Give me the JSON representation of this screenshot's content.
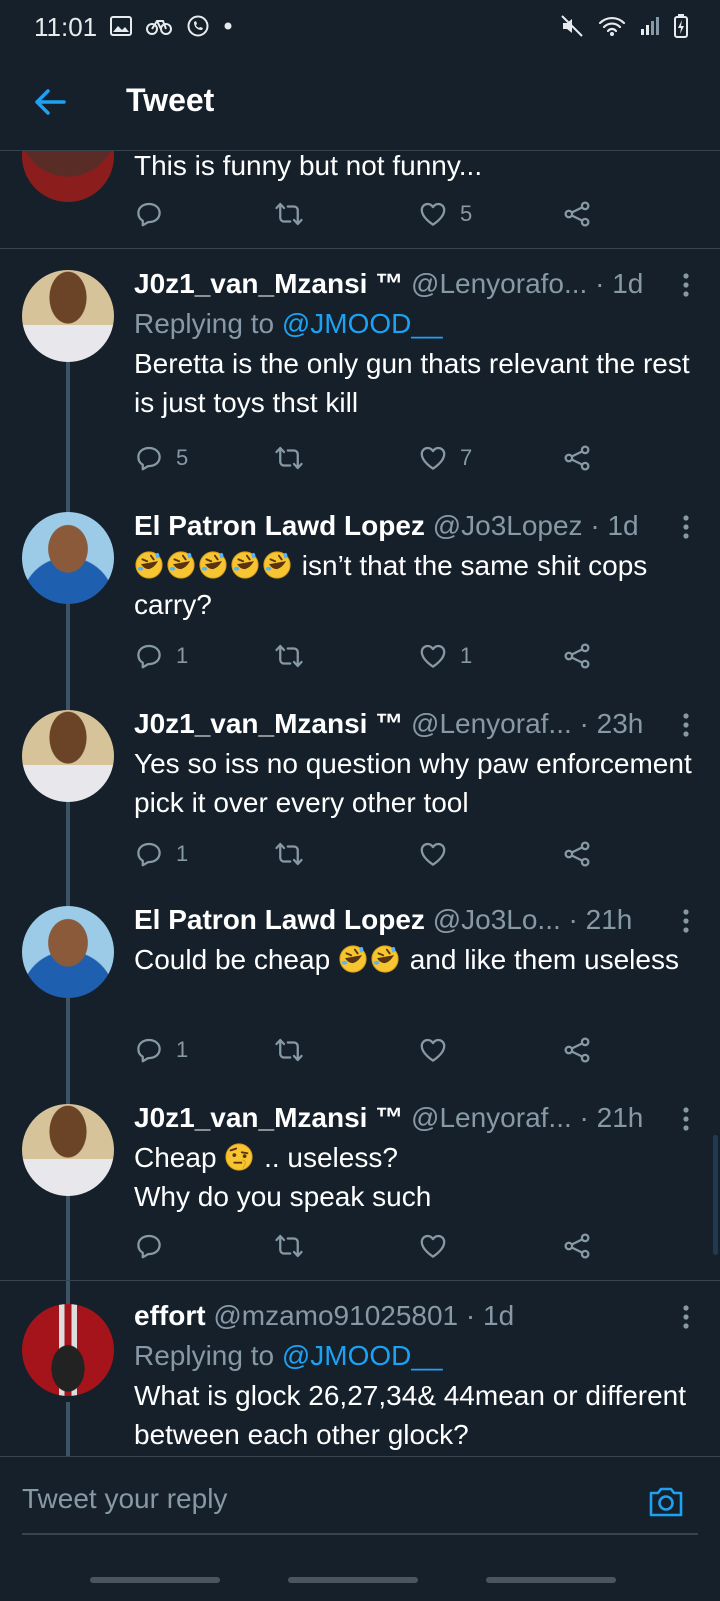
{
  "status_bar": {
    "time": "11:01"
  },
  "header": {
    "title": "Tweet"
  },
  "top_partial_tweet": {
    "text": "This is funny but not funny...",
    "replies": "",
    "retweets": "",
    "likes": "5"
  },
  "tweets": [
    {
      "name": "J0z1_van_Mzansi ™",
      "handle": "@Lenyorafo...",
      "time": "· 1d",
      "replying_label": "Replying to",
      "replying_to": "@JMOOD__",
      "text": "Beretta is the only gun thats relevant the rest is just toys thst kill",
      "replies": "5",
      "likes": "7"
    },
    {
      "name": "El Patron Lawd Lopez",
      "handle": "@Jo3Lopez",
      "time": "· 1d",
      "emoji": [
        "rofl",
        "rofl",
        "rofl",
        "rofl",
        "rofl"
      ],
      "text": " isn’t that the same shit cops carry?",
      "replies": "1",
      "likes": "1"
    },
    {
      "name": "J0z1_van_Mzansi ™",
      "handle": "@Lenyoraf...",
      "time": "· 23h",
      "text": "Yes so iss no question why paw enforcement pick it over every other tool",
      "replies": "1",
      "likes": ""
    },
    {
      "name": "El Patron Lawd Lopez",
      "handle": "@Jo3Lo...",
      "time": "· 21h",
      "text_before": "Could be cheap ",
      "emoji": [
        "rofl",
        "rofl"
      ],
      "text_after": " and like them useless",
      "replies": "1",
      "likes": ""
    },
    {
      "name": "J0z1_van_Mzansi ™",
      "handle": "@Lenyoraf...",
      "time": "· 21h",
      "text_before": "Cheap ",
      "emoji": [
        "raised-eyebrow"
      ],
      "text_after": " .. useless?",
      "text_line2": "Why do you speak such",
      "replies": "",
      "likes": ""
    },
    {
      "name": "effort",
      "handle": "@mzamo91025801",
      "time": "· 1d",
      "replying_label": "Replying to",
      "replying_to": "@JMOOD__",
      "text": "What is glock 26,27,34& 44mean or different between each other glock?"
    }
  ],
  "reply_bar": {
    "placeholder": "Tweet your reply"
  },
  "colors": {
    "background": "#15202b",
    "accent": "#1da1f2",
    "muted": "#8899a6",
    "divider": "#38444d"
  }
}
